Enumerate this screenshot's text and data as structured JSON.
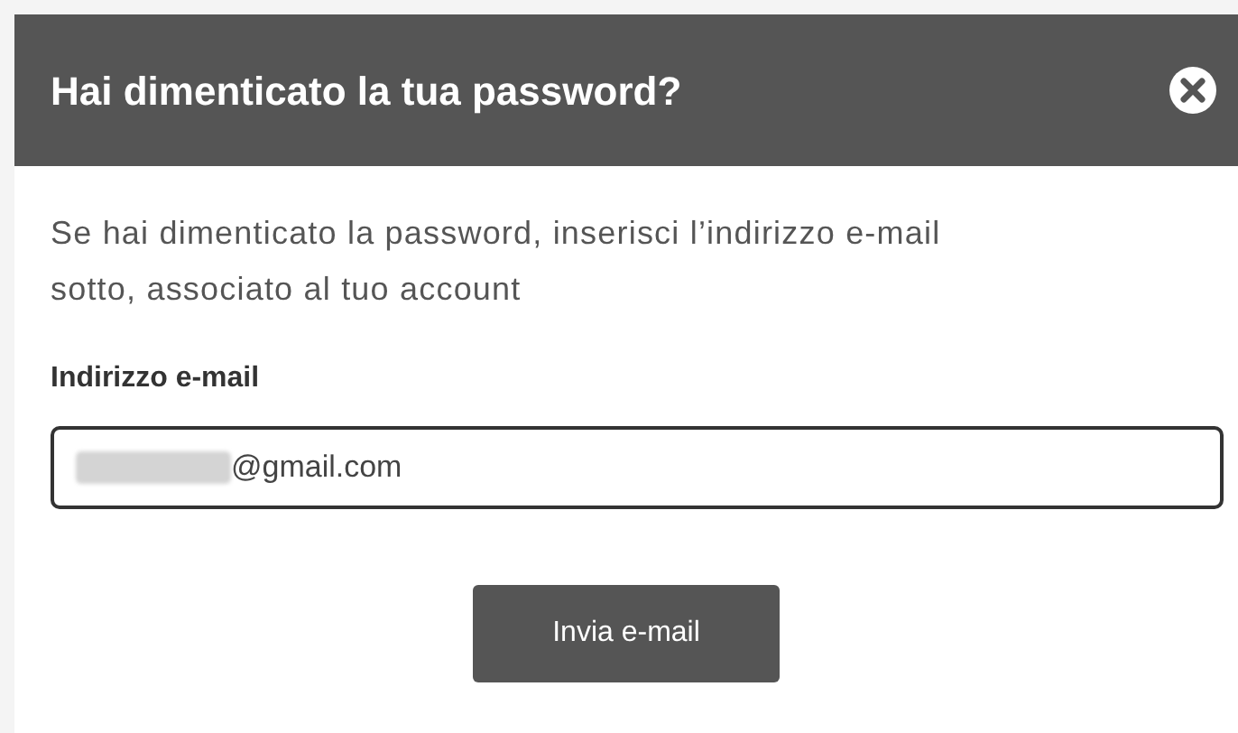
{
  "dialog": {
    "title": "Hai dimenticato la tua password?",
    "description": "Se hai dimenticato la password, inserisci l’indirizzo e-mail sotto, associato al tuo account",
    "email_field": {
      "label": "Indirizzo e-mail",
      "value": "@gmail.com",
      "redacted_prefix": true
    },
    "submit_button": "Invia e-mail"
  }
}
